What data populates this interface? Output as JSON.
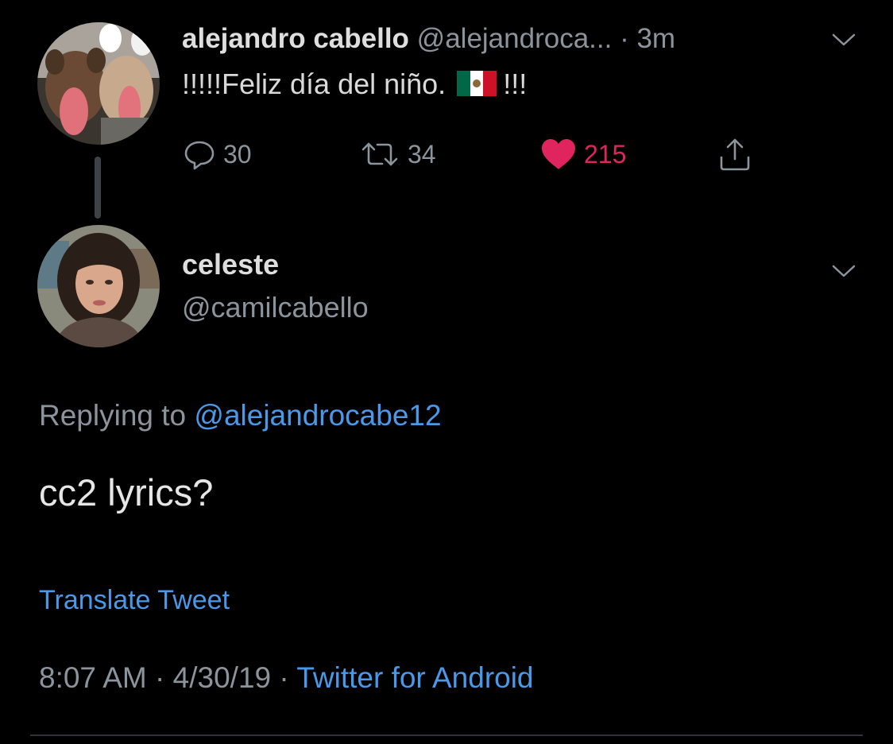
{
  "parent_tweet": {
    "display_name": "alejandro cabello",
    "handle": "@alejandroca...",
    "time": " · 3m",
    "text_before_flag": "!!!!!Feliz día del niño.",
    "text_after_flag": "!!!",
    "flag_icon": "mexico-flag-icon",
    "stats": {
      "replies": "30",
      "retweets": "34",
      "likes": "215"
    },
    "colors": {
      "like": "#e0245e",
      "muted": "#8b949c"
    }
  },
  "reply_tweet": {
    "display_name": "celeste",
    "handle": "@camilcabello",
    "replying_prefix": "Replying to ",
    "replying_handle": "@alejandrocabe12",
    "text": "cc2 lyrics?",
    "translate_label": "Translate Tweet",
    "time": "8:07 AM",
    "separator": " · ",
    "date": "4/30/19",
    "source": "Twitter for Android"
  },
  "theme": {
    "background": "#000000",
    "link": "#4a99e9",
    "divider": "#2f3336"
  }
}
